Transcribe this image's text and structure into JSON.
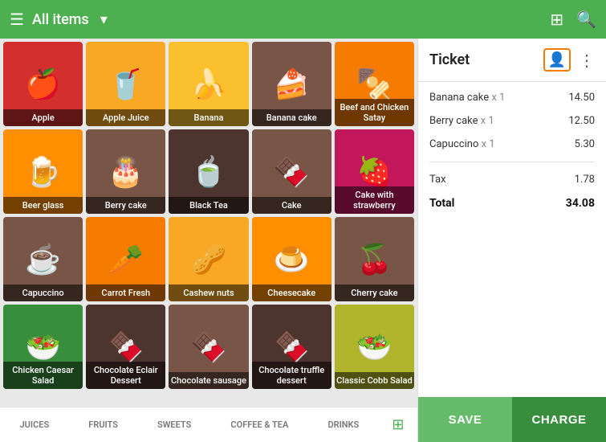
{
  "header": {
    "menu_icon": "☰",
    "title": "All items",
    "dropdown_icon": "▾",
    "scan_icon": "⊞",
    "search_icon": "🔍"
  },
  "categories": [
    {
      "id": "juices",
      "label": "JUICES",
      "active": false
    },
    {
      "id": "fruits",
      "label": "FRUITS",
      "active": false
    },
    {
      "id": "sweets",
      "label": "SWEETS",
      "active": false
    },
    {
      "id": "coffee-tea",
      "label": "COFFEE & TEA",
      "active": false
    },
    {
      "id": "drinks",
      "label": "DRINKS",
      "active": false
    }
  ],
  "grid_items": [
    {
      "id": "apple",
      "label": "Apple",
      "emoji": "🍎",
      "bg": "bg-red"
    },
    {
      "id": "apple-juice",
      "label": "Apple Juice",
      "emoji": "🥤",
      "bg": "bg-yellow"
    },
    {
      "id": "banana",
      "label": "Banana",
      "emoji": "🍌",
      "bg": "bg-yellow2"
    },
    {
      "id": "banana-cake",
      "label": "Banana cake",
      "emoji": "🍰",
      "bg": "bg-brown"
    },
    {
      "id": "beef-chicken-satay",
      "label": "Beef and Chicken Satay",
      "emoji": "🍢",
      "bg": "bg-orange"
    },
    {
      "id": "beer-glass",
      "label": "Beer glass",
      "emoji": "🍺",
      "bg": "bg-amber"
    },
    {
      "id": "berry-cake",
      "label": "Berry cake",
      "emoji": "🎂",
      "bg": "bg-brown"
    },
    {
      "id": "black-tea",
      "label": "Black Tea",
      "emoji": "🍵",
      "bg": "bg-dark"
    },
    {
      "id": "cake",
      "label": "Cake",
      "emoji": "🍫",
      "bg": "bg-brown"
    },
    {
      "id": "cake-strawberry",
      "label": "Cake with strawberry",
      "emoji": "🍓",
      "bg": "bg-pink"
    },
    {
      "id": "capuccino",
      "label": "Capuccino",
      "emoji": "☕",
      "bg": "bg-brown"
    },
    {
      "id": "carrot-fresh",
      "label": "Carrot Fresh",
      "emoji": "🥕",
      "bg": "bg-orange"
    },
    {
      "id": "cashew-nuts",
      "label": "Cashew nuts",
      "emoji": "🥜",
      "bg": "bg-yellow"
    },
    {
      "id": "cheesecake",
      "label": "Cheesecake",
      "emoji": "🍮",
      "bg": "bg-amber"
    },
    {
      "id": "cherry-cake",
      "label": "Cherry cake",
      "emoji": "🍒",
      "bg": "bg-brown"
    },
    {
      "id": "chicken-caesar",
      "label": "Chicken Caesar Salad",
      "emoji": "🥗",
      "bg": "bg-green"
    },
    {
      "id": "choc-eclair",
      "label": "Chocolate Eclair Dessert",
      "emoji": "🍫",
      "bg": "bg-dark"
    },
    {
      "id": "choc-sausage",
      "label": "Chocolate sausage",
      "emoji": "🍫",
      "bg": "bg-brown"
    },
    {
      "id": "choc-truffle",
      "label": "Chocolate truffle dessert",
      "emoji": "🍫",
      "bg": "bg-dark"
    },
    {
      "id": "classic-cobb",
      "label": "Classic Cobb Salad",
      "emoji": "🥗",
      "bg": "bg-lime"
    }
  ],
  "ticket": {
    "title": "Ticket",
    "items": [
      {
        "name": "Banana cake",
        "qty": "x 1",
        "price": "14.50"
      },
      {
        "name": "Berry cake",
        "qty": "x 1",
        "price": "12.50"
      },
      {
        "name": "Capuccino",
        "qty": "x 1",
        "price": "5.30"
      }
    ],
    "tax_label": "Tax",
    "tax_value": "1.78",
    "total_label": "Total",
    "total_value": "34.08"
  },
  "buttons": {
    "save": "SAVE",
    "charge": "CHARGE"
  },
  "colors": {
    "green_primary": "#4caf50",
    "green_dark": "#388e3c",
    "green_light": "#66bb6a",
    "orange_accent": "#f57c00"
  }
}
